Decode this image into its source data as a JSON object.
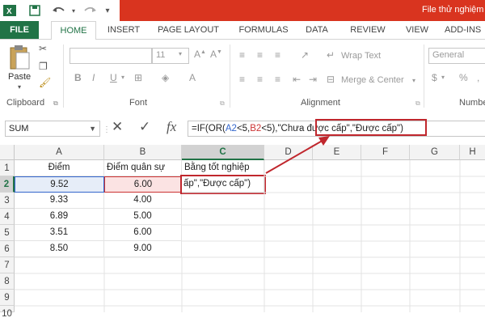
{
  "titlebar": {
    "filename": "File thử nghiệm"
  },
  "tabs": [
    "FILE",
    "HOME",
    "INSERT",
    "PAGE LAYOUT",
    "FORMULAS",
    "DATA",
    "REVIEW",
    "VIEW",
    "ADD-INS"
  ],
  "ribbon": {
    "paste_label": "Paste",
    "clipboard_label": "Clipboard",
    "font_label": "Font",
    "font_size": "11",
    "bold": "B",
    "italic": "I",
    "underline": "U",
    "wrap_text": "Wrap Text",
    "merge_center": "Merge & Center",
    "alignment_label": "Alignment",
    "number_format": "General",
    "number_label": "Numbe",
    "percent": "%",
    "comma": ","
  },
  "formula_bar": {
    "name_box": "SUM",
    "formula_parts": [
      {
        "text": "=IF(OR(",
        "color": "#222222"
      },
      {
        "text": "A2",
        "color": "#3366cc"
      },
      {
        "text": "<5,",
        "color": "#222222"
      },
      {
        "text": "B2",
        "color": "#cc3333"
      },
      {
        "text": "<5),\"Chưa được cấp\",\"Được cấp\")",
        "color": "#222222"
      }
    ]
  },
  "columns": [
    "A",
    "B",
    "C",
    "D",
    "E",
    "F",
    "G",
    "H"
  ],
  "rows": [
    "1",
    "2",
    "3",
    "4",
    "5",
    "6",
    "7",
    "8",
    "9",
    "10"
  ],
  "cells": {
    "A1": "Điểm",
    "B1": "Điểm quân sự",
    "C1": "Bằng tốt nghiệp",
    "A": [
      "9.52",
      "9.33",
      "6.89",
      "3.51",
      "8.50"
    ],
    "B": [
      "6.00",
      "4.00",
      "5.00",
      "6.00",
      "9.00"
    ],
    "C2": "ấp\",\"Được cấp\")"
  },
  "colors": {
    "excel_green": "#217346",
    "title_red": "#d9341f",
    "annotation_red": "#c0272d"
  }
}
